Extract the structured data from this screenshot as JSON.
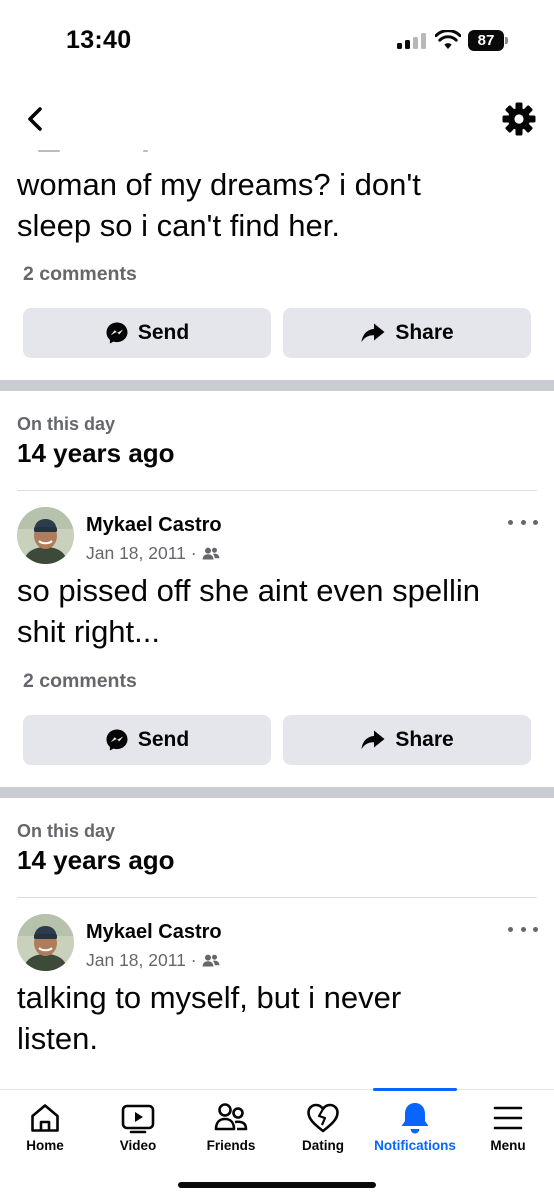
{
  "status_bar": {
    "time": "13:40",
    "battery": "87"
  },
  "posts": [
    {
      "text_lines": [
        "woman of my dreams? i don't",
        "sleep so i can't find her."
      ],
      "comments": "2 comments",
      "send_label": "Send",
      "share_label": "Share"
    },
    {
      "on_this_day_label": "On this day",
      "years_ago": "14 years ago",
      "author": "Mykael Castro",
      "date": "Jan 18, 2011 ·",
      "text_lines": [
        "so pissed off she aint even spellin",
        "shit right..."
      ],
      "comments": "2 comments",
      "send_label": "Send",
      "share_label": "Share"
    },
    {
      "on_this_day_label": "On this day",
      "years_ago": "14 years ago",
      "author": "Mykael Castro",
      "date": "Jan 18, 2011 ·",
      "text_lines": [
        "talking to myself, but i never",
        "listen."
      ]
    }
  ],
  "nav": {
    "items": [
      {
        "label": "Home",
        "icon": "home-icon"
      },
      {
        "label": "Video",
        "icon": "video-icon"
      },
      {
        "label": "Friends",
        "icon": "friends-icon"
      },
      {
        "label": "Dating",
        "icon": "dating-icon"
      },
      {
        "label": "Notifications",
        "icon": "bell-icon",
        "active": true
      },
      {
        "label": "Menu",
        "icon": "menu-icon"
      }
    ]
  },
  "colors": {
    "accent": "#0866ff",
    "secondary_text": "#65676b",
    "button_bg": "#e4e6eb",
    "divider": "#c9ccd1"
  }
}
